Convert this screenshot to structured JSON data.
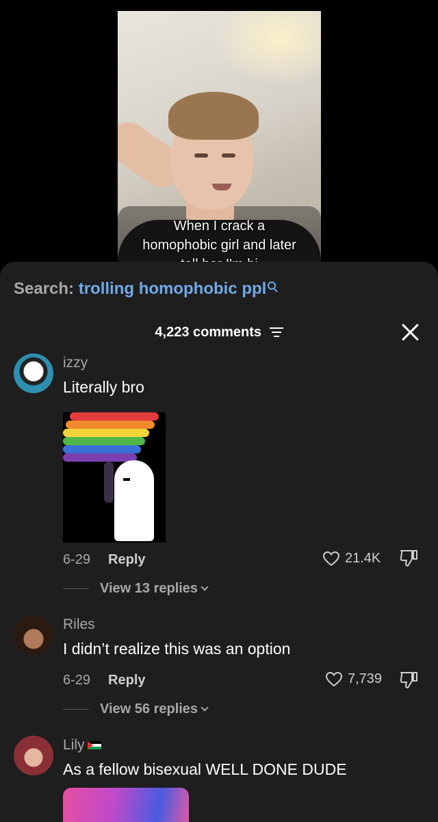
{
  "video": {
    "caption_lines": [
      "When I crack a",
      "homophobic girl and later",
      "tell her I'm bi"
    ]
  },
  "sheet": {
    "search_label": "Search:",
    "search_term": "trolling homophobic ppl",
    "comment_count": "4,223 comments"
  },
  "comments": [
    {
      "username": "izzy",
      "text": "Literally bro",
      "date": "6-29",
      "reply_label": "Reply",
      "likes": "21.4K",
      "view_replies": "View 13 replies"
    },
    {
      "username": "Riles",
      "text": "I didn’t realize this was an option",
      "date": "6-29",
      "reply_label": "Reply",
      "likes": "7,739",
      "view_replies": "View 56 replies"
    },
    {
      "username": "Lily",
      "text": "As a fellow bisexual WELL DONE DUDE"
    }
  ],
  "colors": {
    "sheet_bg": "#1e1e1e",
    "search_term": "#6ea9e8",
    "muted": "#a8a8a8"
  },
  "icons": [
    "search-icon",
    "filter-icon",
    "close-icon",
    "heart-icon",
    "dislike-icon",
    "chevron-down-icon",
    "palestine-flag-icon"
  ]
}
